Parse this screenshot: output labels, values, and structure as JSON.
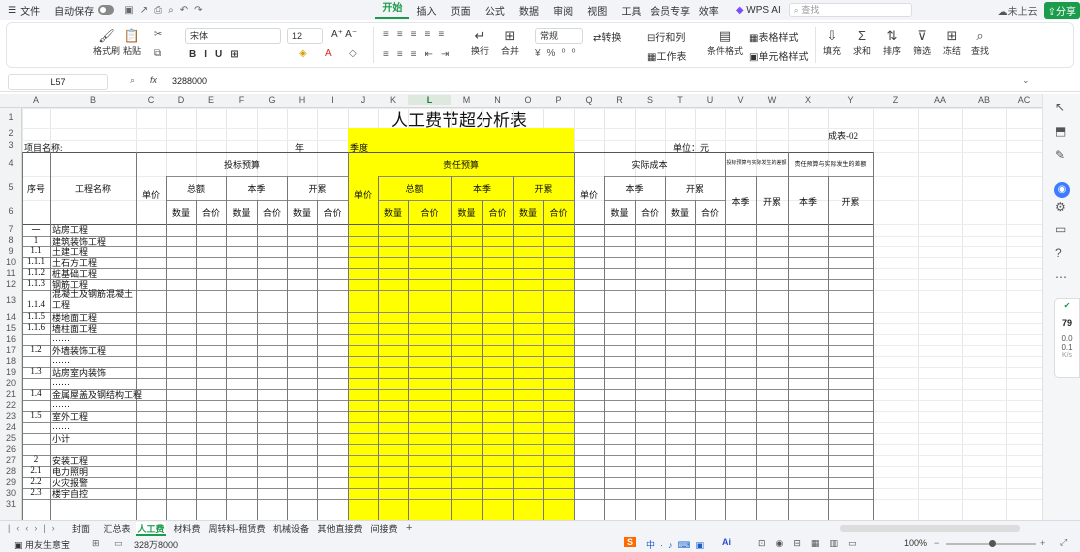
{
  "menu": {
    "file": "文件",
    "autosave": "自动保存",
    "tabs": [
      "开始",
      "插入",
      "页面",
      "公式",
      "数据",
      "审阅",
      "视图",
      "工具",
      "会员专享",
      "效率"
    ],
    "wps_ai": "WPS AI",
    "search_placeholder": "查找",
    "cloud": "未上云",
    "share": "分享"
  },
  "ribbon": {
    "format_painter": "格式刷",
    "paste": "粘贴",
    "font_name": "宋体",
    "font_size": "12",
    "wrap": "换行",
    "merge": "合并",
    "number_format": "常规",
    "convert": "转换",
    "rows_cols": "行和列",
    "worksheet": "工作表",
    "cond_format": "条件格式",
    "table_style": "表格样式",
    "cell_style": "单元格样式",
    "fill": "填充",
    "sum": "求和",
    "sort": "排序",
    "filter": "筛选",
    "freeze": "冻结",
    "find": "查找"
  },
  "formula_bar": {
    "cell_ref": "L57",
    "fx": "fx",
    "value": "3288000"
  },
  "columns": [
    "A",
    "B",
    "C",
    "D",
    "E",
    "F",
    "G",
    "H",
    "I",
    "J",
    "K",
    "L",
    "M",
    "N",
    "O",
    "P",
    "Q",
    "R",
    "S",
    "T",
    "U",
    "V",
    "W",
    "X",
    "Y",
    "Z",
    "AA",
    "AB",
    "AC"
  ],
  "rows": [
    "1",
    "2",
    "3",
    "4",
    "5",
    "6",
    "7",
    "8",
    "9",
    "10",
    "11",
    "12",
    "13",
    "14",
    "15",
    "16",
    "17",
    "18",
    "19",
    "20",
    "21",
    "22",
    "23",
    "24",
    "25",
    "26",
    "27",
    "28",
    "29",
    "30",
    "31"
  ],
  "sheet": {
    "title": "人工费节超分析表",
    "form_no": "成表-02",
    "project_label": "项目名称:",
    "year_label": "年",
    "quarter_label": "季度",
    "unit_label": "单位：元",
    "h_seq": "序号",
    "h_name": "工程名称",
    "h_bid": "投标预算",
    "h_resp": "责任预算",
    "h_actual": "实际成本",
    "h_diff1": "投标预算与实际发生的差额",
    "h_diff2": "责任预算与实际发生的差额",
    "h_unit_price": "单价",
    "h_total": "总额",
    "h_quarter": "本季",
    "h_cumul": "开累",
    "h_qty": "数量",
    "h_amt": "合价",
    "items": [
      {
        "n": "一",
        "name": "站房工程"
      },
      {
        "n": "1",
        "name": "建筑装饰工程"
      },
      {
        "n": "1.1",
        "name": "土建工程"
      },
      {
        "n": "1.1.1",
        "name": "土石方工程"
      },
      {
        "n": "1.1.2",
        "name": "桩基础工程"
      },
      {
        "n": "1.1.3",
        "name": "钢筋工程"
      },
      {
        "n": "1.1.4",
        "name": "混凝土及钢筋混凝土工程"
      },
      {
        "n": "1.1.5",
        "name": "楼地面工程"
      },
      {
        "n": "1.1.6",
        "name": "墙柱面工程"
      },
      {
        "n": "",
        "name": "……"
      },
      {
        "n": "1.2",
        "name": "外墙装饰工程"
      },
      {
        "n": "",
        "name": "……"
      },
      {
        "n": "1.3",
        "name": "站房室内装饰"
      },
      {
        "n": "",
        "name": "……"
      },
      {
        "n": "1.4",
        "name": "金属屋盖及钢结构工程"
      },
      {
        "n": "",
        "name": "……"
      },
      {
        "n": "1.5",
        "name": "室外工程"
      },
      {
        "n": "",
        "name": "……"
      },
      {
        "n": "",
        "name": "小计"
      },
      {
        "n": "",
        "name": ""
      },
      {
        "n": "2",
        "name": "安装工程"
      },
      {
        "n": "2.1",
        "name": "电力照明"
      },
      {
        "n": "2.2",
        "name": "火灾报警"
      },
      {
        "n": "2.3",
        "name": "楼宇自控"
      }
    ]
  },
  "sheet_tabs": [
    "封面",
    "汇总表",
    "人工费",
    "材料费",
    "周转料-租赁费",
    "机械设备",
    "其他直接费",
    "间接费"
  ],
  "status": {
    "user": "用友生意宝",
    "value": "328万8000",
    "zoom": "100%"
  },
  "perf": {
    "score": "79",
    "v1": "0.0",
    "v2": "0.1",
    "u": "K/s"
  }
}
